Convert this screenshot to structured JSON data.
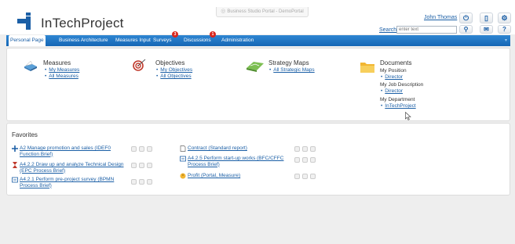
{
  "header": {
    "app_name": "InTechProject",
    "browser_tab": "Business Studio Portal - DemoPortal",
    "user_name": "John Thomas",
    "search_label": "Search",
    "search_placeholder": "enter text",
    "buttons": {
      "power": "⏻",
      "doc": "▯",
      "settings": "⚙",
      "search": "⚲",
      "mail": "✉",
      "help": "?"
    }
  },
  "nav": {
    "items": [
      {
        "label": "Personal Page"
      },
      {
        "label": "Business Architecture"
      },
      {
        "label": "Measures Input"
      },
      {
        "label": "Surveys",
        "badge": "3"
      },
      {
        "label": "Discussions",
        "badge": "1"
      },
      {
        "label": "Administration"
      }
    ]
  },
  "sections": {
    "measures": {
      "title": "Measures",
      "links": [
        "My Measures",
        "All Measures"
      ]
    },
    "objectives": {
      "title": "Objectives",
      "links": [
        "My Objectives",
        "All Objectives"
      ]
    },
    "strategy": {
      "title": "Strategy Maps",
      "links": [
        "All Strategic Maps"
      ]
    },
    "documents": {
      "title": "Documents",
      "position_label": "My Position",
      "position_link": "Director",
      "job_label": "My Job Description",
      "job_link": "Director",
      "dept_label": "My Department",
      "dept_link": "InTechProject"
    }
  },
  "favorites": {
    "title": "Favorites",
    "items": [
      {
        "text": "A2 Manage promotion and sales (IDEF0 Function Brief)",
        "icon": "process-icon"
      },
      {
        "text": "A4.2.2 Draw up and analyze Technical Design (EPC Process Brief)",
        "icon": "hourglass-icon"
      },
      {
        "text": "A4.2.1 Perform pre-project survey (BPMN Process Brief)",
        "icon": "diagram-icon"
      },
      {
        "text": "Contract (Standard report)",
        "icon": "report-icon"
      },
      {
        "text": "A4.2.5 Perform start-up works (BFC/CFFC Process Brief)",
        "icon": "diagram-icon"
      },
      {
        "text": "Profit (Portal, Measure)",
        "icon": "measure-icon"
      }
    ]
  },
  "colors": {
    "accent": "#1b5fa6",
    "nav": "#1a6fc0",
    "badge": "#d9261c"
  }
}
